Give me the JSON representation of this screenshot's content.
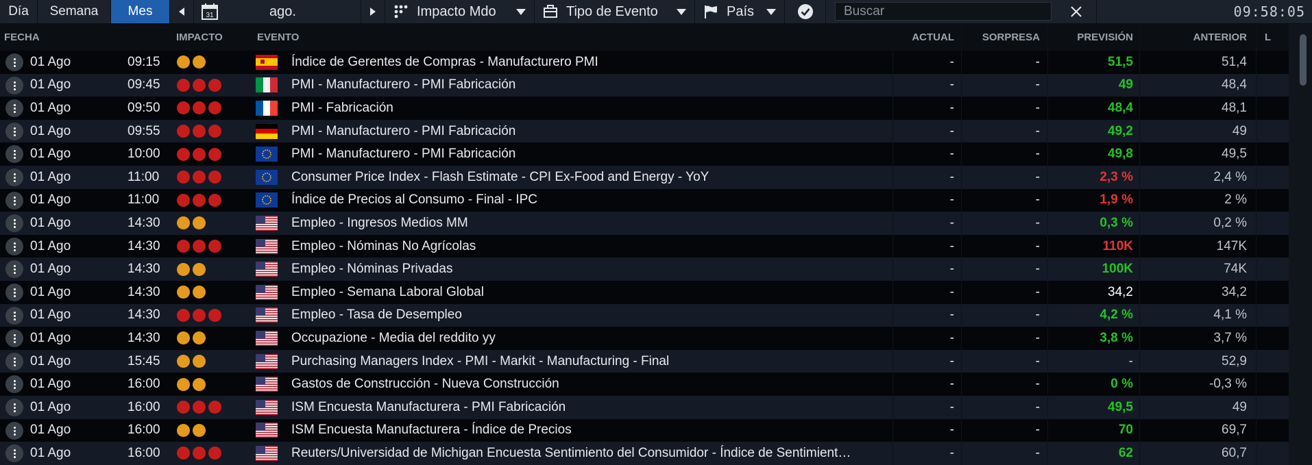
{
  "toolbar": {
    "view_day": "Día",
    "view_week": "Semana",
    "view_month": "Mes",
    "calendar_day": "31",
    "month_label": "ago.",
    "impact_filter": "Impacto Mdo",
    "event_type_filter": "Tipo de Evento",
    "country_filter": "País",
    "search_placeholder": "Buscar",
    "clock": "09:58:05"
  },
  "table": {
    "columns": {
      "date": "FECHA",
      "impact": "IMPACTO",
      "event": "EVENTO",
      "actual": "ACTUAL",
      "surprise": "SORPRESA",
      "forecast": "PREVISIÓN",
      "previous": "ANTERIOR",
      "extra": "L"
    },
    "colors": {
      "impact_high": "#c71c1c",
      "impact_medium": "#e49a1e",
      "forecast_up": "#22c422",
      "forecast_down": "#e23636",
      "forecast_neutral": "#ffffff"
    },
    "rows": [
      {
        "date": "01 Ago",
        "time": "09:15",
        "impact": 2,
        "flag": "es",
        "event": "Índice de Gerentes de Compras - Manufacturero PMI",
        "actual": "-",
        "surprise": "-",
        "forecast": "51,5",
        "forecast_color": "up",
        "previous": "51,4"
      },
      {
        "date": "01 Ago",
        "time": "09:45",
        "impact": 3,
        "flag": "it",
        "event": "PMI - Manufacturero - PMI Fabricación",
        "actual": "-",
        "surprise": "-",
        "forecast": "49",
        "forecast_color": "up",
        "previous": "48,4"
      },
      {
        "date": "01 Ago",
        "time": "09:50",
        "impact": 3,
        "flag": "fr",
        "event": "PMI - Fabricación",
        "actual": "-",
        "surprise": "-",
        "forecast": "48,4",
        "forecast_color": "up",
        "previous": "48,1"
      },
      {
        "date": "01 Ago",
        "time": "09:55",
        "impact": 3,
        "flag": "de",
        "event": "PMI - Manufacturero - PMI Fabricación",
        "actual": "-",
        "surprise": "-",
        "forecast": "49,2",
        "forecast_color": "up",
        "previous": "49"
      },
      {
        "date": "01 Ago",
        "time": "10:00",
        "impact": 3,
        "flag": "eu",
        "event": "PMI - Manufacturero - PMI Fabricación",
        "actual": "-",
        "surprise": "-",
        "forecast": "49,8",
        "forecast_color": "up",
        "previous": "49,5"
      },
      {
        "date": "01 Ago",
        "time": "11:00",
        "impact": 3,
        "flag": "eu",
        "event": "Consumer Price Index - Flash Estimate - CPI Ex-Food and Energy - YoY",
        "actual": "-",
        "surprise": "-",
        "forecast": "2,3 %",
        "forecast_color": "down",
        "previous": "2,4 %"
      },
      {
        "date": "01 Ago",
        "time": "11:00",
        "impact": 3,
        "flag": "eu",
        "event": "Índice de Precios al Consumo - Final - IPC",
        "actual": "-",
        "surprise": "-",
        "forecast": "1,9 %",
        "forecast_color": "down",
        "previous": "2 %"
      },
      {
        "date": "01 Ago",
        "time": "14:30",
        "impact": 2,
        "flag": "us",
        "event": "Empleo - Ingresos Medios MM",
        "actual": "-",
        "surprise": "-",
        "forecast": "0,3 %",
        "forecast_color": "up",
        "previous": "0,2 %"
      },
      {
        "date": "01 Ago",
        "time": "14:30",
        "impact": 3,
        "flag": "us",
        "event": "Empleo - Nóminas No Agrícolas",
        "actual": "-",
        "surprise": "-",
        "forecast": "110K",
        "forecast_color": "down",
        "previous": "147K"
      },
      {
        "date": "01 Ago",
        "time": "14:30",
        "impact": 2,
        "flag": "us",
        "event": "Empleo - Nóminas Privadas",
        "actual": "-",
        "surprise": "-",
        "forecast": "100K",
        "forecast_color": "up",
        "previous": "74K"
      },
      {
        "date": "01 Ago",
        "time": "14:30",
        "impact": 2,
        "flag": "us",
        "event": "Empleo - Semana Laboral Global",
        "actual": "-",
        "surprise": "-",
        "forecast": "34,2",
        "forecast_color": "neutral",
        "previous": "34,2"
      },
      {
        "date": "01 Ago",
        "time": "14:30",
        "impact": 3,
        "flag": "us",
        "event": "Empleo - Tasa de Desempleo",
        "actual": "-",
        "surprise": "-",
        "forecast": "4,2 %",
        "forecast_color": "up",
        "previous": "4,1 %"
      },
      {
        "date": "01 Ago",
        "time": "14:30",
        "impact": 2,
        "flag": "us",
        "event": "Occupazione - Media del reddito yy",
        "actual": "-",
        "surprise": "-",
        "forecast": "3,8 %",
        "forecast_color": "up",
        "previous": "3,7 %"
      },
      {
        "date": "01 Ago",
        "time": "15:45",
        "impact": 2,
        "flag": "us",
        "event": "Purchasing Managers Index - PMI - Markit - Manufacturing - Final",
        "actual": "-",
        "surprise": "-",
        "forecast": "-",
        "forecast_color": "dash",
        "previous": "52,9"
      },
      {
        "date": "01 Ago",
        "time": "16:00",
        "impact": 2,
        "flag": "us",
        "event": "Gastos de Construcción - Nueva Construcción",
        "actual": "-",
        "surprise": "-",
        "forecast": "0 %",
        "forecast_color": "up",
        "previous": "-0,3 %"
      },
      {
        "date": "01 Ago",
        "time": "16:00",
        "impact": 3,
        "flag": "us",
        "event": "ISM Encuesta Manufacturera - PMI Fabricación",
        "actual": "-",
        "surprise": "-",
        "forecast": "49,5",
        "forecast_color": "up",
        "previous": "49"
      },
      {
        "date": "01 Ago",
        "time": "16:00",
        "impact": 2,
        "flag": "us",
        "event": "ISM Encuesta Manufacturera - Índice de Precios",
        "actual": "-",
        "surprise": "-",
        "forecast": "70",
        "forecast_color": "up",
        "previous": "69,7"
      },
      {
        "date": "01 Ago",
        "time": "16:00",
        "impact": 3,
        "flag": "us",
        "event": "Reuters/Universidad de Michigan Encuesta Sentimiento del Consumidor - Índice de Sentimient…",
        "actual": "-",
        "surprise": "-",
        "forecast": "62",
        "forecast_color": "up",
        "previous": "60,7"
      }
    ]
  }
}
